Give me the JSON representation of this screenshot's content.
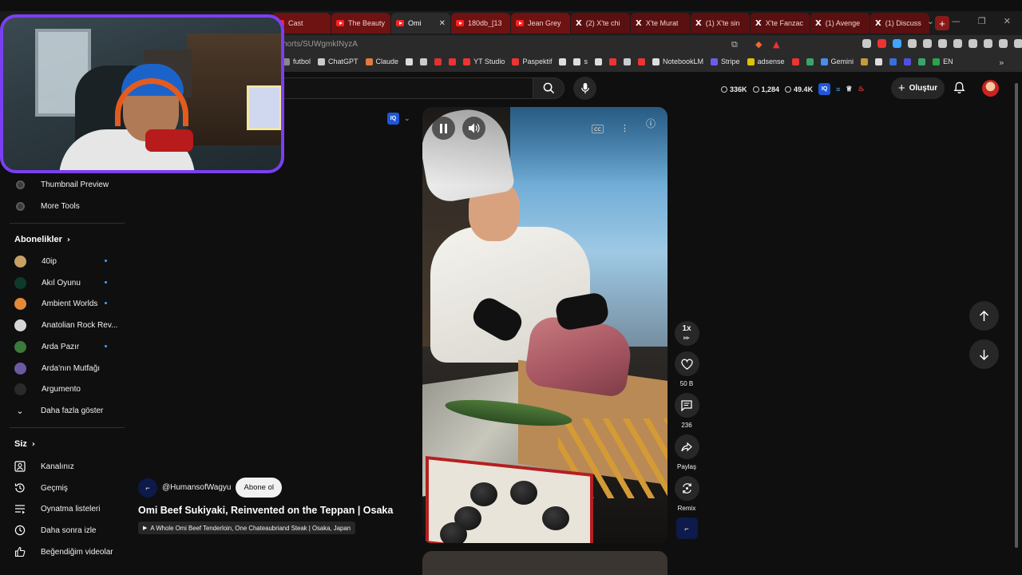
{
  "browser": {
    "tabs": [
      {
        "label": "Cast",
        "kind": "yt"
      },
      {
        "label": "The Beauty",
        "kind": "yt"
      },
      {
        "label": "Omi",
        "kind": "yt",
        "active": true
      },
      {
        "label": "180db_[13",
        "kind": "yt"
      },
      {
        "label": "Jean Grey",
        "kind": "yt"
      },
      {
        "label": "(2) X'te chi",
        "kind": "x"
      },
      {
        "label": "X'te Murat",
        "kind": "x"
      },
      {
        "label": "(1) X'te sin",
        "kind": "x"
      },
      {
        "label": "X'te Fanzac",
        "kind": "x"
      },
      {
        "label": "(1) Avenge",
        "kind": "x"
      },
      {
        "label": "(1) Discuss",
        "kind": "x"
      }
    ],
    "new_tab": "+",
    "url": "horts/SUWgmkINyzA",
    "bookmarks": [
      "futbol",
      "ChatGPT",
      "Claude",
      "",
      "",
      "",
      "",
      "YT Studio",
      "Paspektif",
      "",
      "s",
      "",
      "",
      "",
      "",
      "NotebookLM",
      "Stripe",
      "adsense",
      "",
      "",
      "Gemini",
      "",
      "",
      "",
      "",
      "",
      "EN"
    ]
  },
  "header": {
    "stats": {
      "subs": "336K",
      "count": "1,284",
      "views": "49.4K"
    },
    "create_label": "Oluştur"
  },
  "sidebar": {
    "tools": [
      {
        "label": "Thumbnail Preview"
      },
      {
        "label": "More Tools"
      }
    ],
    "subscriptions_title": "Abonelikler",
    "subscriptions": [
      {
        "label": "40ip",
        "color": "#c9a064",
        "new": true
      },
      {
        "label": "Akıl Oyunu",
        "color": "#0f3a2a",
        "new": true
      },
      {
        "label": "Ambient Worlds",
        "color": "#e4883a",
        "new": true
      },
      {
        "label": "Anatolian Rock Rev...",
        "color": "#d6d6d6",
        "new": false
      },
      {
        "label": "Arda Pazır",
        "color": "#3a7a3a",
        "new": true
      },
      {
        "label": "Arda'nın Mutfağı",
        "color": "#6b5aa0",
        "new": false
      },
      {
        "label": "Argumento",
        "color": "#2a2a2a",
        "new": false
      }
    ],
    "show_more": "Daha fazla göster",
    "you_title": "Siz",
    "you_items": [
      {
        "label": "Kanalınız",
        "icon": "channel-icon"
      },
      {
        "label": "Geçmiş",
        "icon": "history-icon"
      },
      {
        "label": "Oynatma listeleri",
        "icon": "playlists-icon"
      },
      {
        "label": "Daha sonra izle",
        "icon": "watch-later-icon"
      },
      {
        "label": "Beğendiğim videolar",
        "icon": "liked-icon"
      }
    ]
  },
  "player": {
    "speed": "1x",
    "likes": "50 B",
    "comments": "236",
    "share": "Paylaş",
    "remix": "Remix"
  },
  "video": {
    "channel": "@HumansofWagyu",
    "subscribe": "Abone ol",
    "title": "Omi Beef Sukiyaki, Reinvented on the Teppan | Osaka",
    "playlist": "A Whole Omi Beef Tenderloin, One Chateaubriand Steak | Osaka, Japan"
  },
  "iq_badge": "IQ",
  "colors": {
    "accent": "#ff0000",
    "webcam_border": "#7b3ff2",
    "subscribe_bg": "#f1f1f1",
    "tab_red": "#6e1212"
  }
}
